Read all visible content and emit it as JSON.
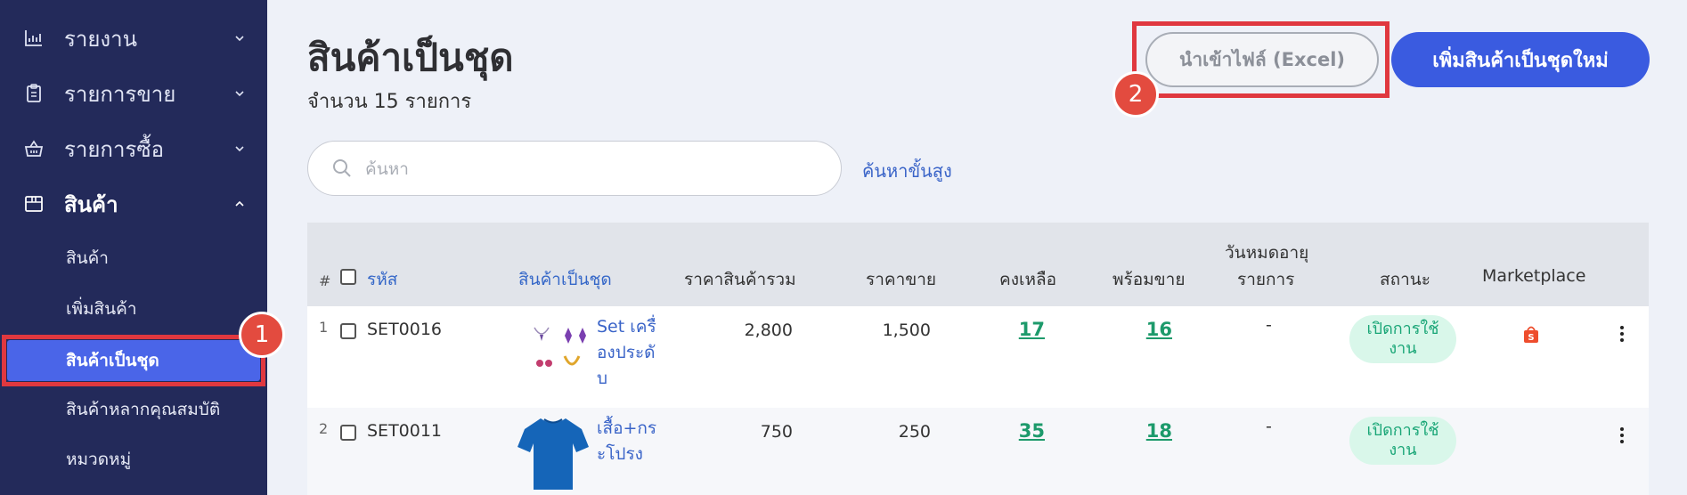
{
  "sidebar": {
    "nav": [
      {
        "label": "รายงาน",
        "icon": "chart-icon"
      },
      {
        "label": "รายการขาย",
        "icon": "clipboard-icon"
      },
      {
        "label": "รายการซื้อ",
        "icon": "basket-icon"
      },
      {
        "label": "สินค้า",
        "icon": "box-icon"
      }
    ],
    "sub": [
      "สินค้า",
      "เพิ่มสินค้า",
      "สินค้าเป็นชุด",
      "สินค้าหลากคุณสมบัติ",
      "หมวดหมู่"
    ]
  },
  "annotations": {
    "badge1": "1",
    "badge2": "2",
    "highlight_color": "#e0383f"
  },
  "header": {
    "title": "สินค้าเป็นชุด",
    "count": "จำนวน 15 รายการ",
    "import_button": "นำเข้าไฟล์ (Excel)",
    "add_button": "เพิ่มสินค้าเป็นชุดใหม่"
  },
  "search": {
    "placeholder": "ค้นหา",
    "advanced": "ค้นหาขั้นสูง"
  },
  "table": {
    "columns": {
      "index": "#",
      "code": "รหัส",
      "bundle": "สินค้าเป็นชุด",
      "total_price": "ราคาสินค้ารวม",
      "sell_price": "ราคาขาย",
      "remaining": "คงเหลือ",
      "ready": "พร้อมขาย",
      "expiry_1": "วันหมดอายุ",
      "expiry_2": "รายการ",
      "status": "สถานะ",
      "marketplace": "Marketplace"
    },
    "rows": [
      {
        "index": "1",
        "code": "SET0016",
        "name": "Set เครื่องประดับ",
        "name_lines": [
          "Set เครื่",
          "องประดั",
          "บ"
        ],
        "total_price": "2,800",
        "sell_price": "1,500",
        "remaining": "17",
        "ready": "16",
        "expiry": "-",
        "status_lines": [
          "เปิดการใช้",
          "งาน"
        ],
        "marketplace": "shopee-icon"
      },
      {
        "index": "2",
        "code": "SET0011",
        "name": "เสื้อ+กระโปรง",
        "name_lines": [
          "เสื้อ+กร",
          "ะโปรง"
        ],
        "total_price": "750",
        "sell_price": "250",
        "remaining": "35",
        "ready": "18",
        "expiry": "-",
        "status_lines": [
          "เปิดการใช้",
          "งาน"
        ],
        "marketplace": ""
      }
    ]
  },
  "colors": {
    "sidebar": "#232a5a",
    "accent": "#3a5be0",
    "active_sub": "#4a65e8",
    "status_bg": "#d9f7ea",
    "status_text": "#1aa677",
    "link": "#3a64c8"
  }
}
